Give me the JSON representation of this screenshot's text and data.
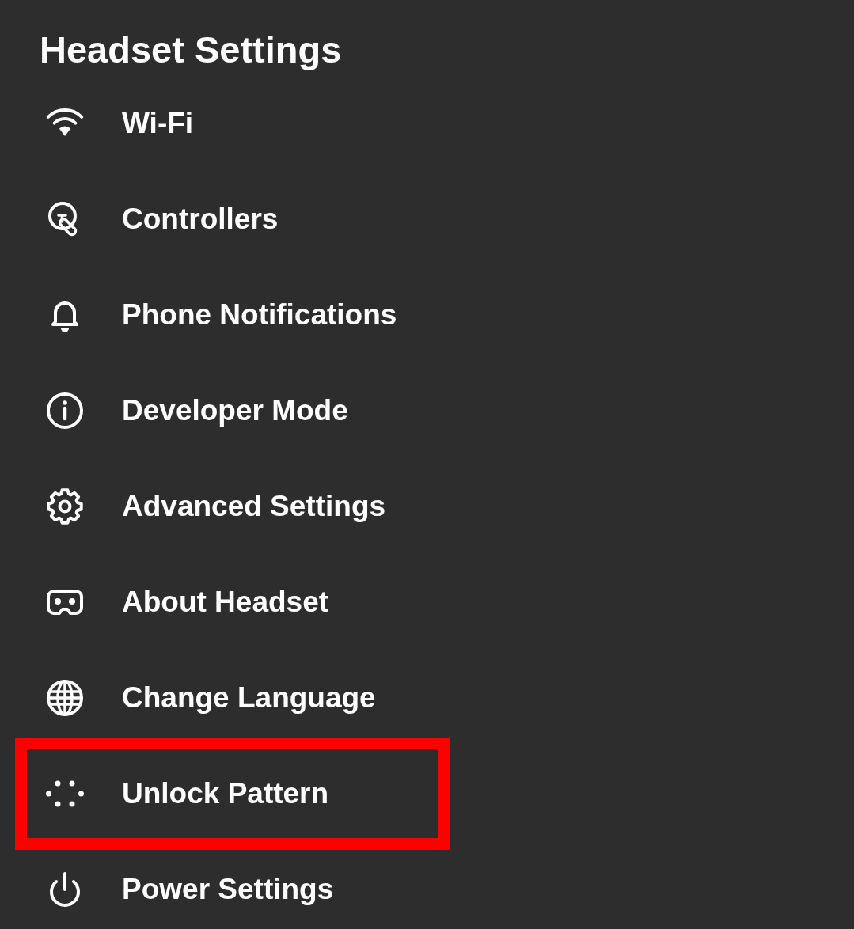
{
  "title": "Headset Settings",
  "items": [
    {
      "label": "Wi-Fi",
      "highlighted": false
    },
    {
      "label": "Controllers",
      "highlighted": false
    },
    {
      "label": "Phone Notifications",
      "highlighted": false
    },
    {
      "label": "Developer Mode",
      "highlighted": false
    },
    {
      "label": "Advanced Settings",
      "highlighted": false
    },
    {
      "label": "About Headset",
      "highlighted": false
    },
    {
      "label": "Change Language",
      "highlighted": false
    },
    {
      "label": "Unlock Pattern",
      "highlighted": true
    },
    {
      "label": "Power Settings",
      "highlighted": false
    }
  ]
}
